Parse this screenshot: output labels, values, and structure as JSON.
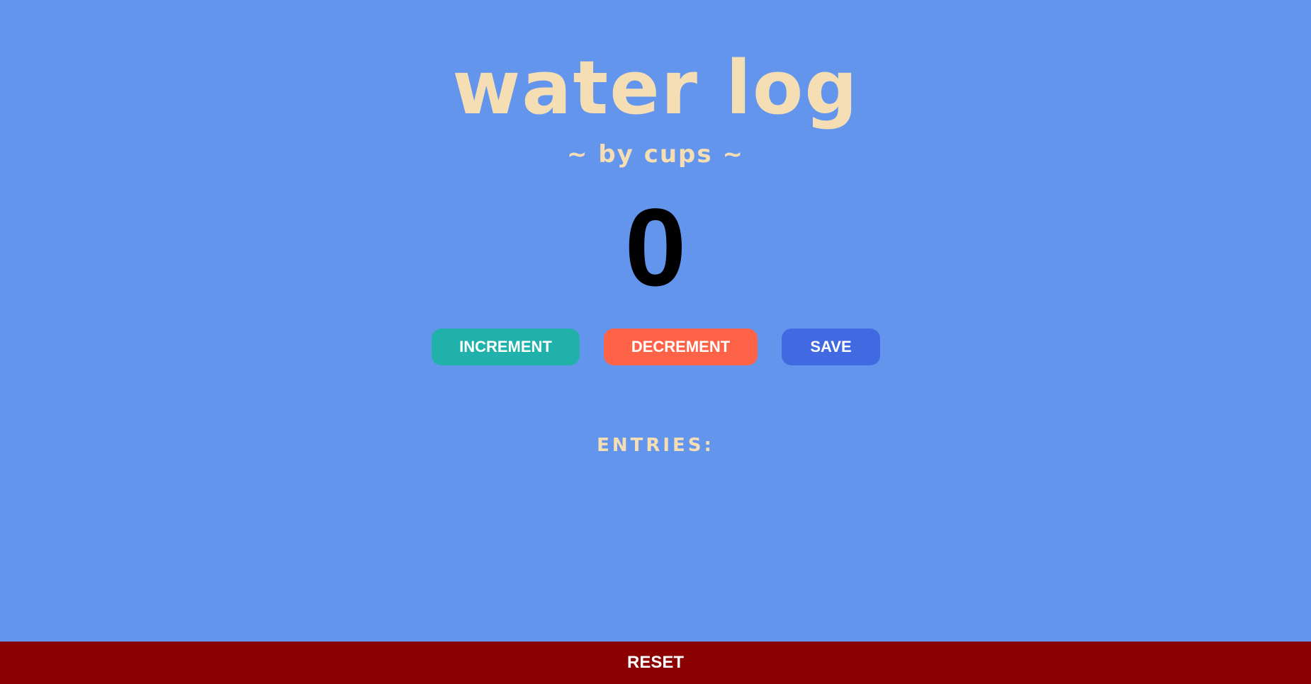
{
  "header": {
    "title": "water log",
    "subtitle": "~ by cups ~"
  },
  "counter": {
    "value": "0"
  },
  "controls": {
    "increment_label": "INCREMENT",
    "decrement_label": "DECREMENT",
    "save_label": "SAVE"
  },
  "entries": {
    "heading": "ENTRIES:",
    "items": []
  },
  "footer": {
    "reset_label": "RESET"
  },
  "colors": {
    "background": "#6495ED",
    "title": "#F5DEB3",
    "increment": "#20B2AA",
    "decrement": "#FF6347",
    "save": "#4169E1",
    "reset": "#8B0000"
  }
}
